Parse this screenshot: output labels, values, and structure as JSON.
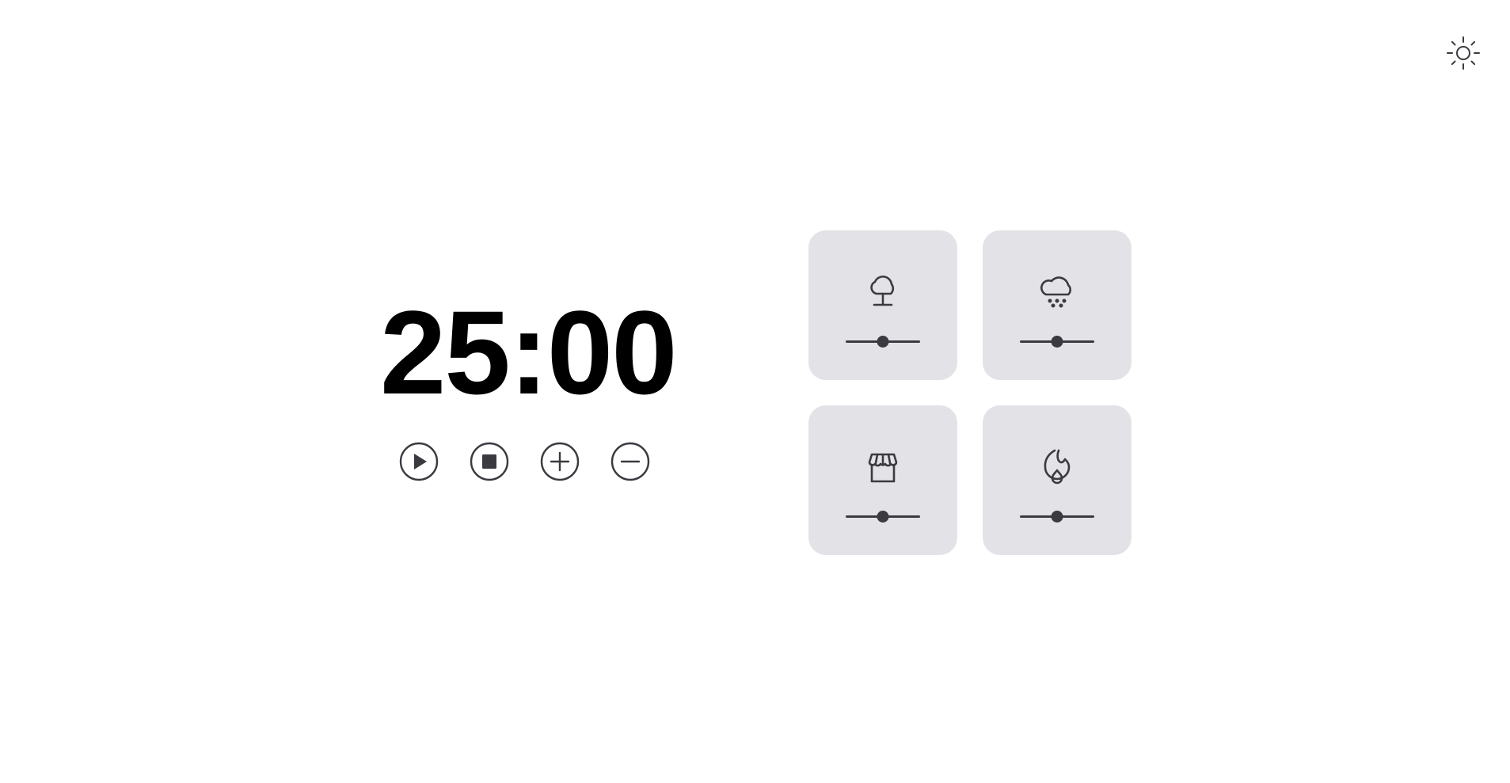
{
  "timer": {
    "display": "25:00"
  },
  "controls": [
    {
      "name": "play",
      "icon": "play-circle-icon"
    },
    {
      "name": "stop",
      "icon": "stop-circle-icon"
    },
    {
      "name": "increase",
      "icon": "plus-circle-icon"
    },
    {
      "name": "decrease",
      "icon": "minus-circle-icon"
    }
  ],
  "theme_toggle": {
    "icon": "sun-icon"
  },
  "sounds": [
    {
      "name": "forest",
      "icon": "tree-icon",
      "volume": 0.5
    },
    {
      "name": "rain",
      "icon": "cloud-rain-icon",
      "volume": 0.5
    },
    {
      "name": "coffee-shop",
      "icon": "storefront-icon",
      "volume": 0.5
    },
    {
      "name": "fireplace",
      "icon": "flame-icon",
      "volume": 0.5
    }
  ],
  "colors": {
    "card_background": "#e3e3e7",
    "icon_stroke": "#3a3a40",
    "text": "#000000",
    "background": "#ffffff"
  }
}
